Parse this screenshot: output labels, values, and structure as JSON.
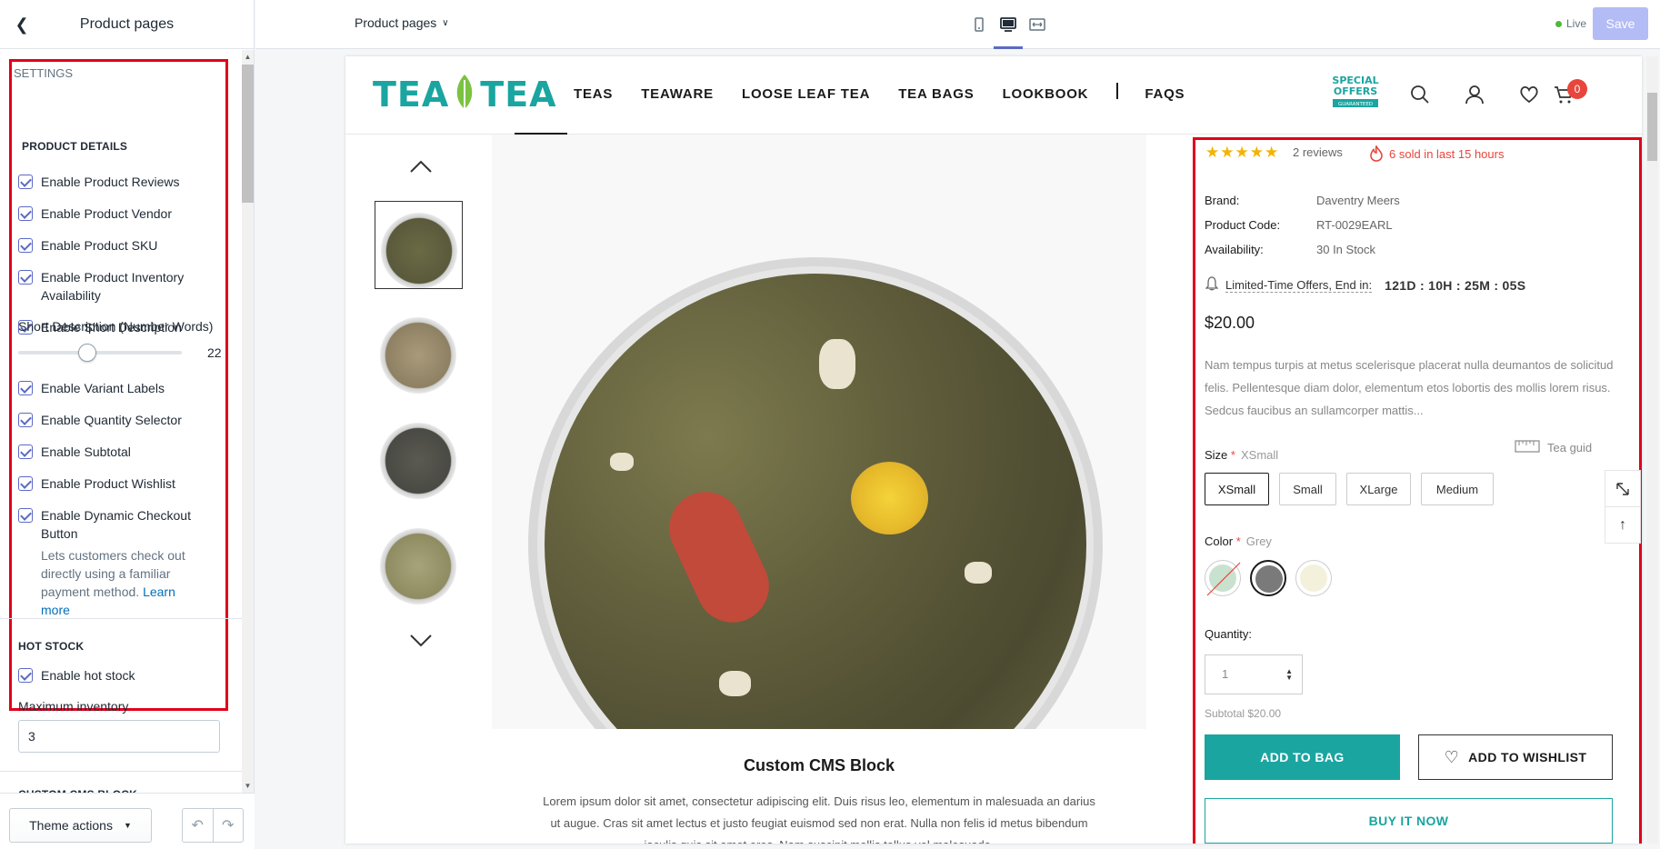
{
  "sidebar": {
    "title": "Product pages",
    "section_label": "Settings",
    "product_details": {
      "heading": "PRODUCT DETAILS",
      "checkboxes": [
        {
          "label": "Enable Product Reviews",
          "checked": true
        },
        {
          "label": "Enable Product Vendor",
          "checked": true
        },
        {
          "label": "Enable Product SKU",
          "checked": true
        },
        {
          "label": "Enable Product Inventory Availability",
          "checked": true
        },
        {
          "label": "Enable Short Description",
          "checked": true
        }
      ],
      "slider": {
        "label": "Short Description (Number Words)",
        "value": "22",
        "fraction": 0.42
      },
      "checkboxes2": [
        {
          "label": "Enable Variant Labels",
          "checked": true
        },
        {
          "label": "Enable Quantity Selector",
          "checked": true
        },
        {
          "label": "Enable Subtotal",
          "checked": true
        },
        {
          "label": "Enable Product Wishlist",
          "checked": true
        },
        {
          "label": "Enable Dynamic Checkout Button",
          "checked": true
        }
      ],
      "dynamic_help": "Lets customers check out directly using a familiar payment method.",
      "learn_more": "Learn more"
    },
    "hot_stock": {
      "heading": "HOT STOCK",
      "checkbox_label": "Enable hot stock",
      "max_label": "Maximum inventory",
      "max_value": "3"
    },
    "next_section": "CUSTOM CMS BLOCK",
    "footer": {
      "theme_actions": "Theme actions"
    }
  },
  "topbar": {
    "page_select": "Product pages",
    "live_label": "Live",
    "save_label": "Save"
  },
  "store": {
    "logo_left": "TEA",
    "logo_right": "TEA",
    "nav": [
      "TEAS",
      "TEAWARE",
      "LOOSE LEAF TEA",
      "TEA BAGS",
      "LOOKBOOK",
      "FAQS"
    ],
    "special_offers": [
      "SPECIAL",
      "OFFERS",
      "GUARANTEED"
    ],
    "cart_count": "0"
  },
  "product": {
    "rating_stars": "★★★★★",
    "reviews": "2 reviews",
    "sold": "6 sold in last 15 hours",
    "brand_label": "Brand:",
    "brand": "Daventry Meers",
    "code_label": "Product Code:",
    "code": "RT-0029EARL",
    "availability_label": "Availability:",
    "availability": "30 In Stock",
    "offer_label": "Limited-Time Offers, End in:",
    "countdown": "121D : 10H : 25M : 05S",
    "price": "$20.00",
    "description": "Nam tempus turpis at metus scelerisque placerat nulla deumantos de solicitud felis. Pellentesque diam dolor, elementum etos lobortis des mollis lorem risus. Sedcus faucibus an sullamcorper mattis...",
    "size_label": "Size",
    "size_current": "XSmall",
    "sizes": [
      "XSmall",
      "Small",
      "XLarge",
      "Medium"
    ],
    "tea_guide": "Tea guid",
    "color_label": "Color",
    "color_current": "Grey",
    "colors": [
      "#c9e2cf",
      "#7a7a7a",
      "#f3f1dc"
    ],
    "quantity_label": "Quantity:",
    "quantity": "1",
    "subtotal": "Subtotal $20.00",
    "add_to_bag": "ADD TO BAG",
    "add_to_wishlist": "ADD TO WISHLIST",
    "buy_now": "BUY IT NOW"
  },
  "cms": {
    "title": "Custom CMS Block",
    "text": "Lorem ipsum dolor sit amet, consectetur adipiscing elit. Duis risus leo, elementum in malesuada an darius ut augue. Cras sit amet lectus et justo feugiat euismod sed non erat. Nulla non felis id metus bibendum iaculis quis sit amet eros. Nam suscipit mollis tellus vel malesuada."
  }
}
